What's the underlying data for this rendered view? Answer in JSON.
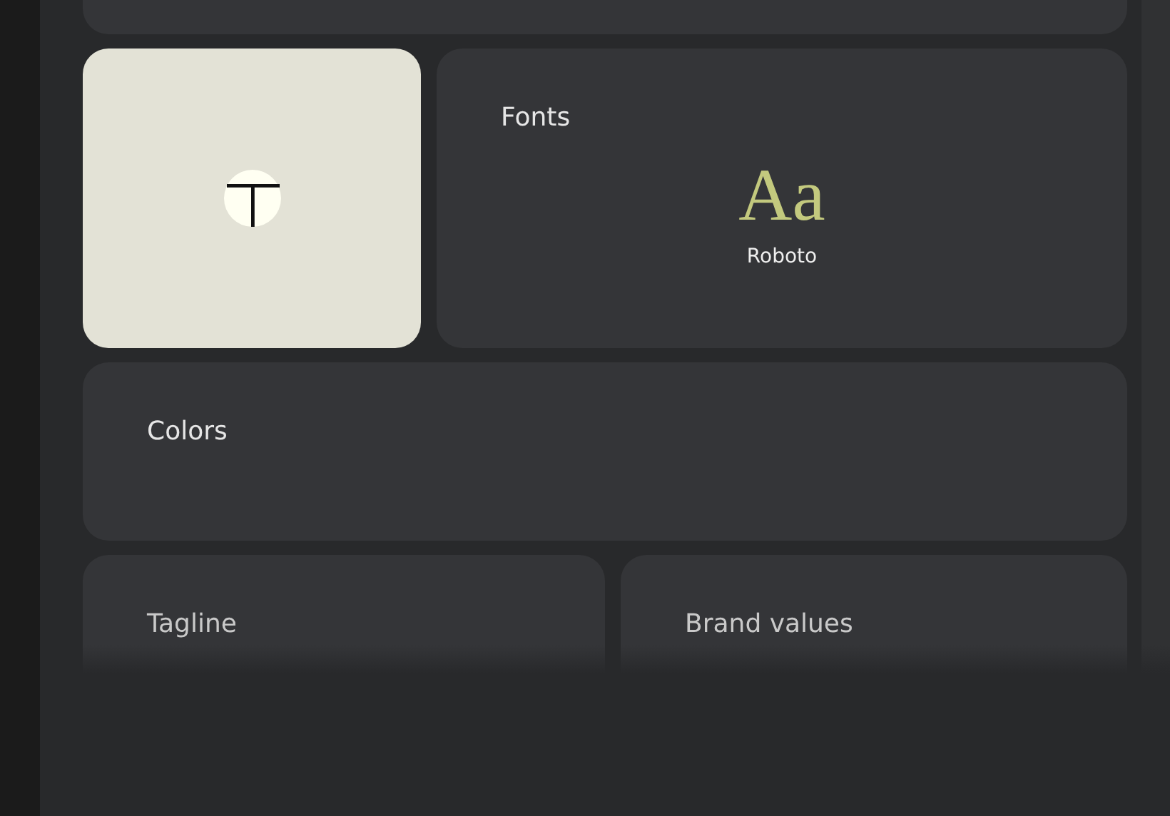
{
  "fonts_card": {
    "title": "Fonts",
    "sample": "Aa",
    "font_name": "Roboto"
  },
  "colors_card": {
    "title": "Colors"
  },
  "bottom_cards": [
    {
      "title": "Tagline"
    },
    {
      "title": "Brand values"
    }
  ]
}
